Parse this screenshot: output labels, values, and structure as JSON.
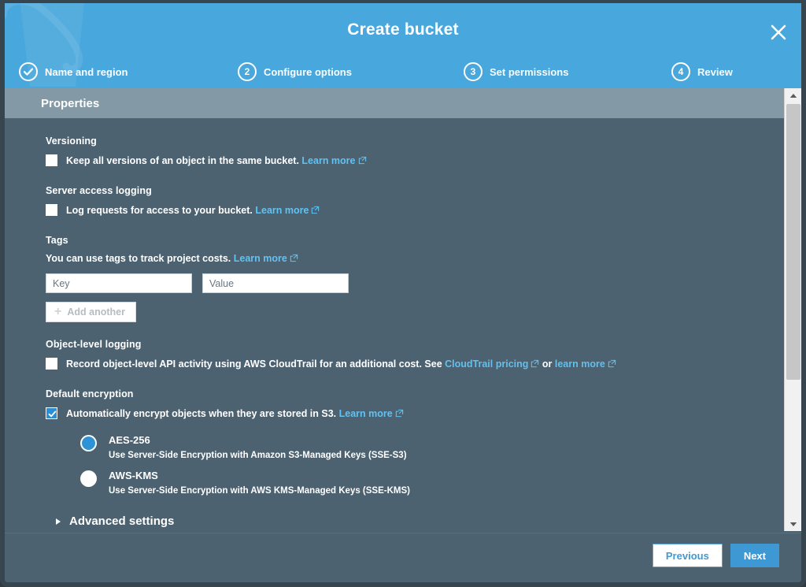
{
  "dialog": {
    "title": "Create bucket",
    "close_icon": "close-icon",
    "section_header": "Properties"
  },
  "steps": [
    {
      "number": "1",
      "label": "Name and region",
      "state": "done"
    },
    {
      "number": "2",
      "label": "Configure options",
      "state": "active"
    },
    {
      "number": "3",
      "label": "Set permissions",
      "state": "pending"
    },
    {
      "number": "4",
      "label": "Review",
      "state": "pending"
    }
  ],
  "versioning": {
    "title": "Versioning",
    "checkbox_label": "Keep all versions of an object in the same bucket.",
    "checked": false,
    "link": "Learn more"
  },
  "server_access_logging": {
    "title": "Server access logging",
    "checkbox_label": "Log requests for access to your bucket.",
    "checked": false,
    "link": "Learn more"
  },
  "tags": {
    "title": "Tags",
    "description": "You can use tags to track project costs.",
    "link": "Learn more",
    "key_placeholder": "Key",
    "key_value": "",
    "value_placeholder": "Value",
    "value_value": "",
    "add_another_label": "Add another",
    "add_another_disabled": true
  },
  "object_level_logging": {
    "title": "Object-level logging",
    "checkbox_label_before": "Record object-level API activity using AWS CloudTrail for an additional cost. See",
    "link_pricing": "CloudTrail pricing",
    "between": "or",
    "link_learn": "learn more",
    "checked": false
  },
  "default_encryption": {
    "title": "Default encryption",
    "checkbox_label": "Automatically encrypt objects when they are stored in S3.",
    "checked": true,
    "link": "Learn more",
    "options": [
      {
        "label": "AES-256",
        "description": "Use Server-Side Encryption with Amazon S3-Managed Keys (SSE-S3)",
        "selected": true
      },
      {
        "label": "AWS-KMS",
        "description": "Use Server-Side Encryption with AWS KMS-Managed Keys (SSE-KMS)",
        "selected": false
      }
    ]
  },
  "advanced": {
    "label": "Advanced settings",
    "expanded": false,
    "caret_icon": "chevron-right-icon"
  },
  "footer": {
    "previous_label": "Previous",
    "next_label": "Next"
  },
  "scrollbar": {
    "up_icon": "triangle-up-icon",
    "down_icon": "triangle-down-icon"
  },
  "colors": {
    "header_blue": "#48a7dc",
    "body_slate": "#4c6270",
    "properties_bar": "#8399a6",
    "link_blue": "#61c2f2",
    "accent_blue": "#3d98d4",
    "checkbox_checked": "#2d8fd2",
    "radio_selected": "#2d93d6"
  }
}
